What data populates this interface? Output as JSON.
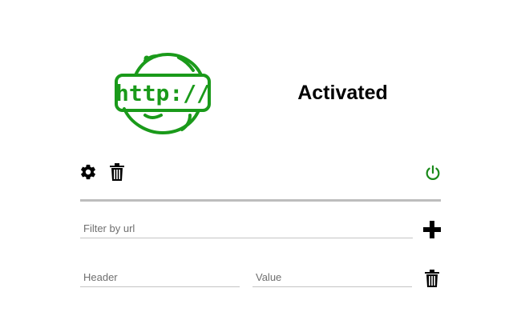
{
  "app": {
    "logo_text": "http://",
    "status_text": "Activated"
  },
  "toolbar": {
    "settings_icon": "gear-icon",
    "delete_icon": "trash-icon",
    "power_icon": "power-icon",
    "power_color": "#1a8a1a"
  },
  "filter": {
    "placeholder": "Filter by url",
    "value": "",
    "add_icon": "plus-icon"
  },
  "header_row": {
    "header_placeholder": "Header",
    "header_value": "",
    "value_placeholder": "Value",
    "value_value": "",
    "delete_icon": "trash-icon"
  },
  "colors": {
    "brand_green": "#1a9a1a",
    "divider": "#bdbdbd"
  }
}
